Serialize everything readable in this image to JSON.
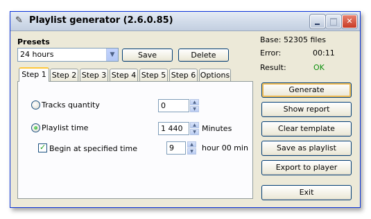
{
  "window": {
    "title": "Playlist generator (2.6.0.85)",
    "icon": "app-icon"
  },
  "presets": {
    "label": "Presets",
    "selected": "24 hours",
    "save_label": "Save",
    "delete_label": "Delete"
  },
  "info": {
    "base": "Base: 52305 files",
    "error_label": "Error:",
    "error_value": "00:11",
    "result_label": "Result:",
    "result_value": "OK",
    "ok_color": "#0c8f0c"
  },
  "tabs": [
    "Step 1",
    "Step 2",
    "Step 3",
    "Step 4",
    "Step 5",
    "Step 6",
    "Options"
  ],
  "active_tab": "Step 1",
  "step1": {
    "tracks_quantity_label": "Tracks quantity",
    "tracks_quantity_value": "0",
    "playlist_time_label": "Playlist time",
    "playlist_time_value": "1 440",
    "playlist_time_unit": "Minutes",
    "begin_label": "Begin at specified time",
    "begin_value": "9",
    "begin_suffix": "hour 00 min",
    "mode": "playlist_time",
    "begin_checked": true
  },
  "actions": {
    "generate": "Generate",
    "show_report": "Show report",
    "clear_template": "Clear template",
    "save_as_playlist": "Save as playlist",
    "export_to_player": "Export to player",
    "exit": "Exit"
  }
}
